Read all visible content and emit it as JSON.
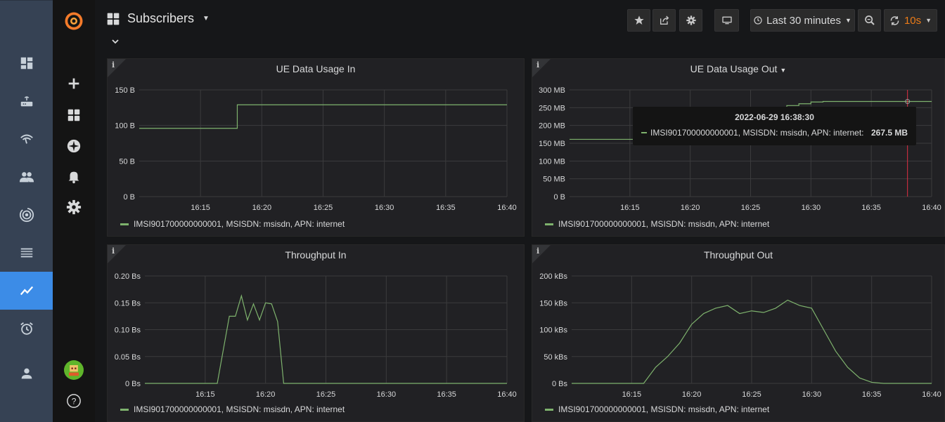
{
  "dashboard": {
    "title": "Subscribers",
    "time_range": "Last 30 minutes",
    "refresh": "10s"
  },
  "icons": {
    "outer_sidebar": [
      "dashboard-icon",
      "router-icon",
      "wifi-icon",
      "people-icon",
      "antenna-icon",
      "table-icon",
      "metrics-icon",
      "alarm-icon",
      "person-icon"
    ],
    "grafana_sidemenu": [
      "grafana-logo-icon",
      "plus-icon",
      "dashboards-icon",
      "compass-icon",
      "bell-icon",
      "gear-icon",
      "user-avatar-icon",
      "help-icon"
    ]
  },
  "colors": {
    "accent": "#3c8ce7",
    "series": "#7eb26d",
    "refresh": "#eb7b18",
    "cursor": "#e02f44"
  },
  "panels": [
    {
      "title": "UE Data Usage In",
      "info": "i",
      "legend": "IMSI901700000000001, MSISDN: msisdn, APN: internet",
      "chart_data": {
        "type": "line",
        "x": [
          "16:10",
          "16:12",
          "16:14",
          "16:16",
          "16:17",
          "16:18",
          "16:20",
          "16:25",
          "16:30",
          "16:35",
          "16:40"
        ],
        "x_ticks": [
          "16:15",
          "16:20",
          "16:25",
          "16:30",
          "16:35",
          "16:40"
        ],
        "y_ticks": [
          "0 B",
          "50 B",
          "100 B",
          "150 B"
        ],
        "ylim": [
          0,
          150
        ],
        "series": [
          {
            "name": "IMSI901700000000001, MSISDN: msisdn, APN: internet",
            "values": [
              96,
              96,
              96,
              96,
              96,
              129,
              129,
              129,
              129,
              129,
              129
            ]
          }
        ]
      }
    },
    {
      "title": "UE Data Usage Out",
      "info": "i",
      "legend": "IMSI901700000000001, MSISDN: msisdn, APN: internet",
      "tooltip": {
        "time": "2022-06-29 16:38:30",
        "series": "IMSI901700000000001, MSISDN: msisdn, APN: internet:",
        "value": "267.5 MB"
      },
      "chart_data": {
        "type": "line",
        "x": [
          "16:10",
          "16:15",
          "16:20",
          "16:25",
          "16:27",
          "16:28",
          "16:29",
          "16:30",
          "16:31",
          "16:35",
          "16:38",
          "16:40"
        ],
        "x_ticks": [
          "16:15",
          "16:20",
          "16:25",
          "16:30",
          "16:35",
          "16:40"
        ],
        "y_ticks": [
          "0 B",
          "50 MB",
          "100 MB",
          "150 MB",
          "200 MB",
          "250 MB",
          "300 MB"
        ],
        "ylim": [
          0,
          300
        ],
        "series": [
          {
            "name": "IMSI901700000000001, MSISDN: msisdn, APN: internet",
            "values": [
              161,
              161,
              161,
              161,
              161,
              256,
              261,
              266,
              267.5,
              267.5,
              267.5,
              267.5
            ]
          }
        ]
      }
    },
    {
      "title": "Throughput In",
      "info": "i",
      "legend": "IMSI901700000000001, MSISDN: msisdn, APN: internet",
      "chart_data": {
        "type": "line",
        "x": [
          "16:10",
          "16:16",
          "16:17",
          "16:17.5",
          "16:18",
          "16:18.5",
          "16:19",
          "16:19.5",
          "16:20",
          "16:20.5",
          "16:21",
          "16:21.5",
          "16:22",
          "16:30",
          "16:40"
        ],
        "x_ticks": [
          "16:15",
          "16:20",
          "16:25",
          "16:30",
          "16:35",
          "16:40"
        ],
        "y_ticks": [
          "0 Bs",
          "0.05 Bs",
          "0.10 Bs",
          "0.15 Bs",
          "0.20 Bs"
        ],
        "ylim": [
          0,
          0.2
        ],
        "series": [
          {
            "name": "IMSI901700000000001, MSISDN: msisdn, APN: internet",
            "values": [
              0,
              0,
              0.125,
              0.125,
              0.163,
              0.118,
              0.148,
              0.118,
              0.15,
              0.148,
              0.115,
              0,
              0,
              0,
              0
            ]
          }
        ]
      }
    },
    {
      "title": "Throughput Out",
      "info": "i",
      "legend": "IMSI901700000000001, MSISDN: msisdn, APN: internet",
      "chart_data": {
        "type": "line",
        "x": [
          "16:10",
          "16:16",
          "16:17",
          "16:18",
          "16:19",
          "16:20",
          "16:21",
          "16:22",
          "16:23",
          "16:24",
          "16:25",
          "16:26",
          "16:27",
          "16:28",
          "16:29",
          "16:30",
          "16:31",
          "16:32",
          "16:33",
          "16:34",
          "16:35",
          "16:36",
          "16:40"
        ],
        "x_ticks": [
          "16:15",
          "16:20",
          "16:25",
          "16:30",
          "16:35",
          "16:40"
        ],
        "y_ticks": [
          "0 Bs",
          "50 kBs",
          "100 kBs",
          "150 kBs",
          "200 kBs"
        ],
        "ylim": [
          0,
          200
        ],
        "series": [
          {
            "name": "IMSI901700000000001, MSISDN: msisdn, APN: internet",
            "values": [
              0,
              0,
              30,
              50,
              75,
              110,
              130,
              140,
              145,
              130,
              135,
              132,
              140,
              155,
              145,
              140,
              100,
              60,
              30,
              10,
              2,
              0,
              0
            ]
          }
        ]
      }
    }
  ]
}
